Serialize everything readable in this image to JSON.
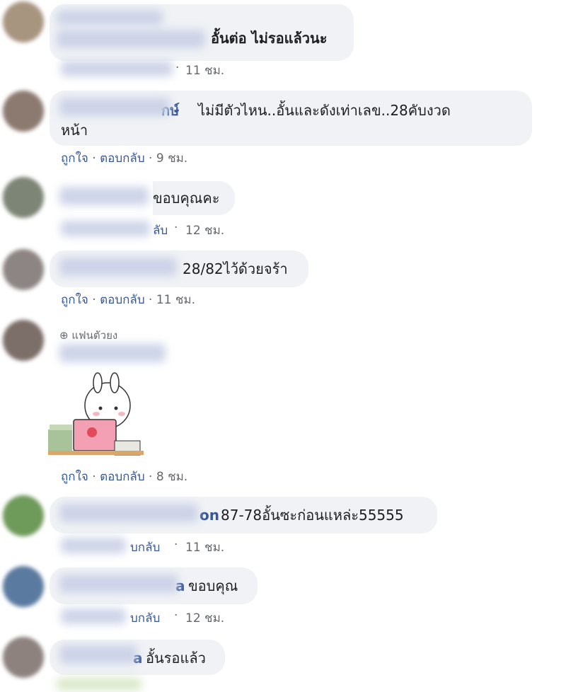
{
  "comments": [
    {
      "text": "อั้นต่อ ไม่รอแล้วนะ",
      "time": "11 ชม."
    },
    {
      "author_tail": "กษ์",
      "text_line1": "ไม่มีตัวไหน..อั้นและดังเท่าเลข..28คับงวด",
      "text_line2": "หน้า",
      "like": "ถูกใจ",
      "reply": "ตอบกลับ",
      "time": "9 ชม."
    },
    {
      "text": "ขอบคุณคะ",
      "reply_tail": "ลับ",
      "time": "12 ชม."
    },
    {
      "text": "28/82ไว้ด้วยจร้า",
      "like": "ถูกใจ",
      "reply": "ตอบกลับ",
      "time": "11 ชม."
    },
    {
      "badge": "แฟนตัวยง",
      "like": "ถูกใจ",
      "reply": "ตอบกลับ",
      "time": "8 ชม."
    },
    {
      "author_tail": "on",
      "text": "87-78อั้นซะก่อนแหล่ะ55555",
      "reply_tail": "บกลับ",
      "time": "11 ชม."
    },
    {
      "author_tail": "a",
      "text": "ขอบคุณ",
      "reply_tail": "บกลับ",
      "time": "12 ชม."
    },
    {
      "author_tail": "a",
      "text": "อั้นรอแล้ว"
    }
  ],
  "colors": {
    "link": "#385898",
    "bubble": "#f0f2f5",
    "meta": "#65676b"
  },
  "icons": {
    "badge_icon": "globe-icon",
    "sticker": "bunny-laptop-sticker"
  }
}
